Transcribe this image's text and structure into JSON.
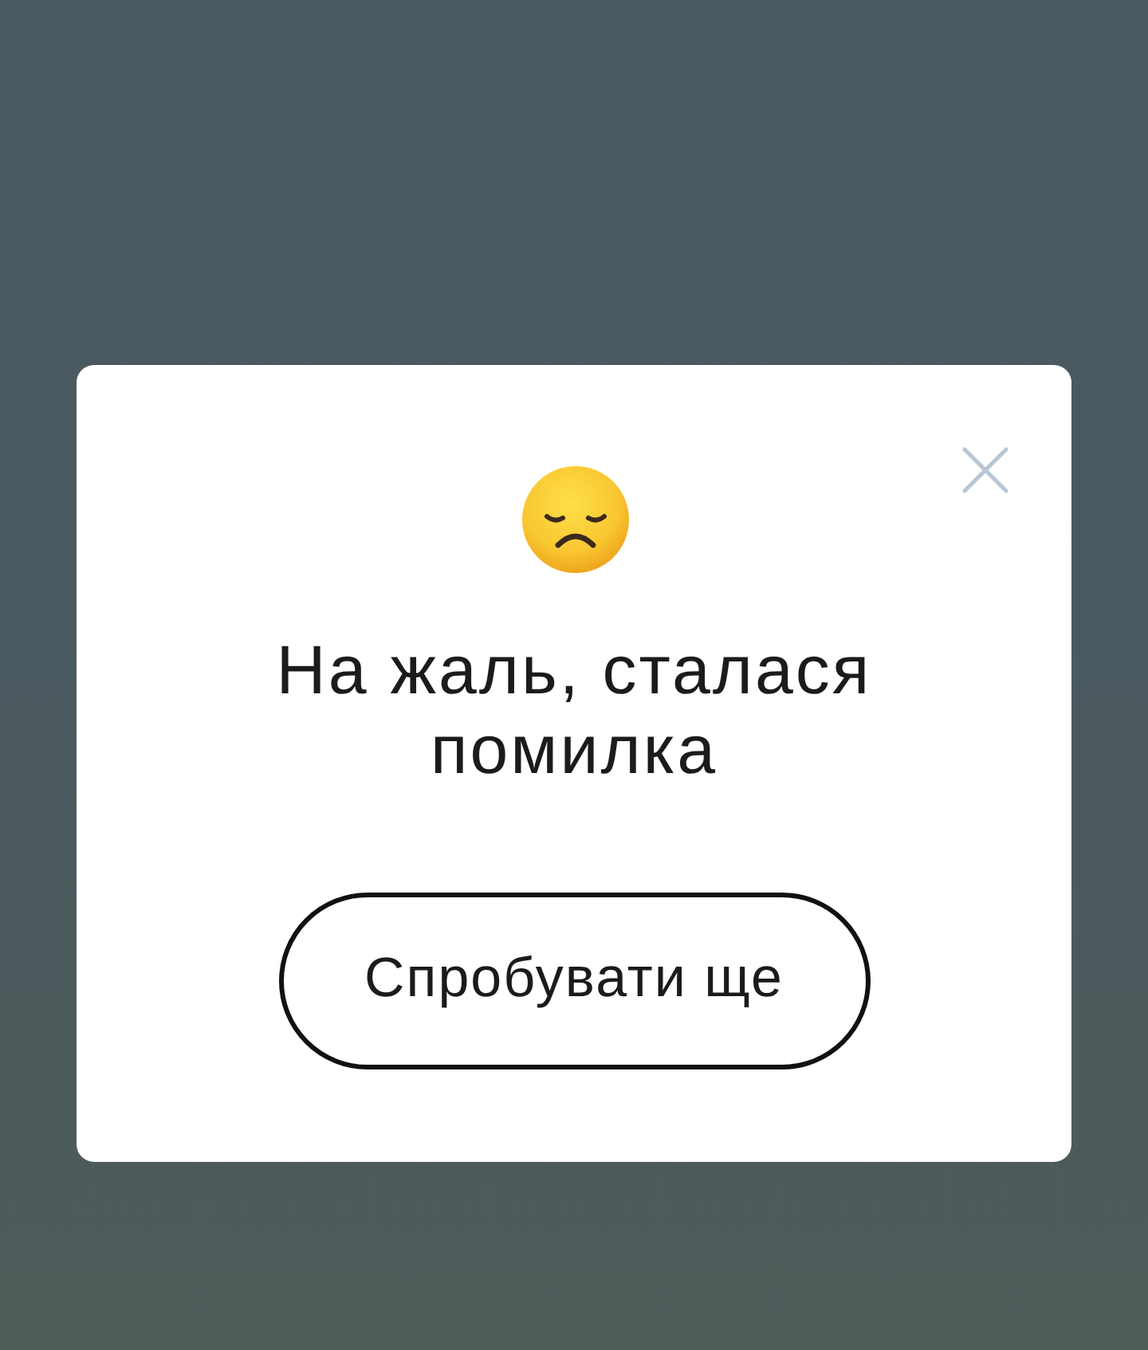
{
  "dialog": {
    "title": "На жаль, сталася помилка",
    "retry_button": {
      "label": "Спробувати ще"
    }
  }
}
